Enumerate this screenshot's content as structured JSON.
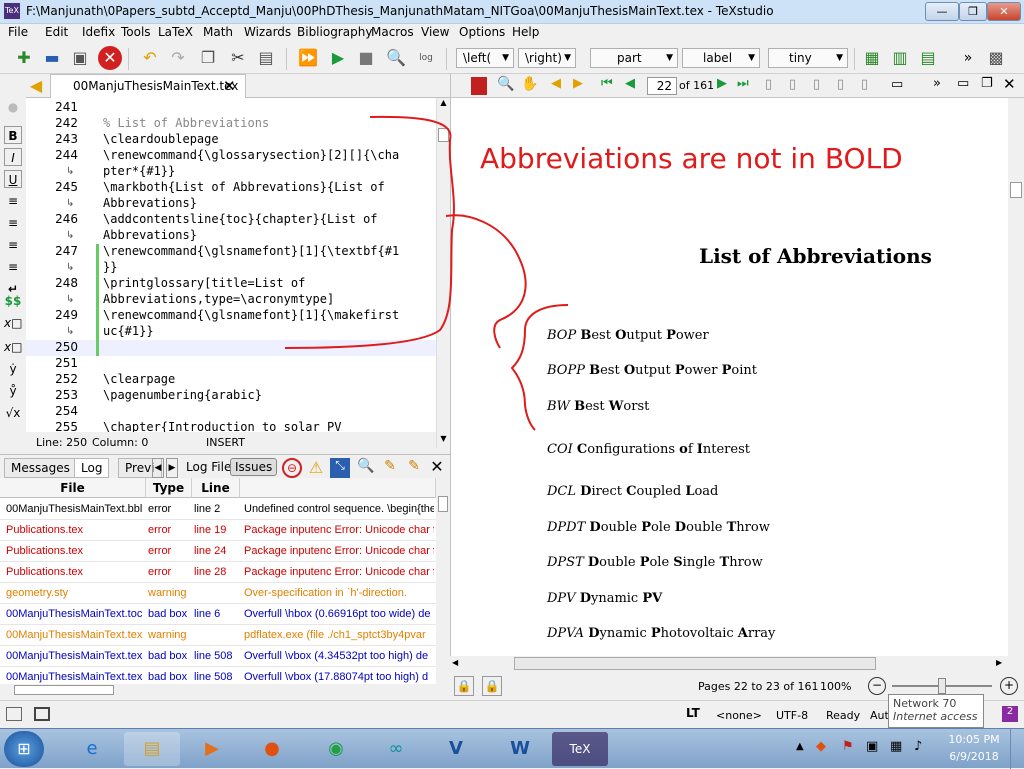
{
  "window": {
    "title": "F:\\Manjunath\\0Papers_subtd_Acceptd_Manju\\00PhDThesis_ManjunathMatam_NITGoa\\00ManjuThesisMainText.tex - TeXstudio",
    "min": "—",
    "max": "❐",
    "close": "✕"
  },
  "menu": [
    "File",
    "Edit",
    "Idefix",
    "Tools",
    "LaTeX",
    "Math",
    "Wizards",
    "Bibliography",
    "Macros",
    "View",
    "Options",
    "Help"
  ],
  "toolbar": {
    "left_combo": "\\left(",
    "right_combo": "\\right)",
    "part_combo": "part",
    "label_combo": "label",
    "size_combo": "tiny",
    "more": "»"
  },
  "left_strip": [
    "B",
    "I",
    "U",
    "≡",
    "≡",
    "≡",
    "≡",
    "↵",
    "$$",
    "x□",
    "x□",
    "ẏ",
    "ẙ",
    "√x"
  ],
  "editor": {
    "tab_label": "00ManjuThesisMainText.tex",
    "tab_close": "✕",
    "lines": [
      {
        "n": "241",
        "t": ""
      },
      {
        "n": "242",
        "t": "% List of Abbreviations"
      },
      {
        "n": "243",
        "t": "\\cleardoublepage"
      },
      {
        "n": "244",
        "t": "\\renewcommand{\\glossarysection}[2][]{\\cha"
      },
      {
        "n": "",
        "t": "pter*{#1}}"
      },
      {
        "n": "245",
        "t": "\\markboth{List of Abbrevations}{List of"
      },
      {
        "n": "",
        "t": "Abbrevations}"
      },
      {
        "n": "246",
        "t": "\\addcontentsline{toc}{chapter}{List of"
      },
      {
        "n": "",
        "t": "Abbrevations}"
      },
      {
        "n": "247",
        "t": "\\renewcommand{\\glsnamefont}[1]{\\textbf{#1"
      },
      {
        "n": "",
        "t": "}}"
      },
      {
        "n": "248",
        "t": "\\printglossary[title=List of"
      },
      {
        "n": "",
        "t": "Abbreviations,type=\\acronymtype]"
      },
      {
        "n": "249",
        "t": "\\renewcommand{\\glsnamefont}[1]{\\makefirst"
      },
      {
        "n": "",
        "t": "uc{#1}}"
      },
      {
        "n": "250",
        "t": ""
      },
      {
        "n": "251",
        "t": ""
      },
      {
        "n": "252",
        "t": "\\clearpage"
      },
      {
        "n": "253",
        "t": "\\pagenumbering{arabic}"
      },
      {
        "n": "254",
        "t": ""
      },
      {
        "n": "255",
        "t": "\\chapter{Introduction to solar PV"
      }
    ],
    "status": {
      "line": "Line: 250",
      "column": "Column: 0",
      "mode": "INSERT"
    }
  },
  "messages": {
    "tabs": [
      "Messages",
      "Log",
      "Previ"
    ],
    "log_file_label": "Log File",
    "issues_label": "Issues",
    "columns": [
      "File",
      "Type",
      "Line"
    ],
    "rows": [
      {
        "file": "00ManjuThesisMainText.bbl",
        "type": "error",
        "line": "line 2",
        "msg": "Undefined control sequence. \\begin{the",
        "color": "#000000"
      },
      {
        "file": "Publications.tex",
        "type": "error",
        "line": "line 19",
        "msg": "Package inputenc Error: Unicode char f",
        "color": "#d00000"
      },
      {
        "file": "Publications.tex",
        "type": "error",
        "line": "line 24",
        "msg": "Package inputenc Error: Unicode char f",
        "color": "#d00000"
      },
      {
        "file": "Publications.tex",
        "type": "error",
        "line": "line 28",
        "msg": "Package inputenc Error: Unicode char f",
        "color": "#d00000"
      },
      {
        "file": "geometry.sty",
        "type": "warning",
        "line": "",
        "msg": "Over-specification in `h'-direction.",
        "color": "#e08000"
      },
      {
        "file": "00ManjuThesisMainText.toc",
        "type": "bad box",
        "line": "line 6",
        "msg": "Overfull \\hbox (0.66916pt too wide) de",
        "color": "#0000c0"
      },
      {
        "file": "00ManjuThesisMainText.tex",
        "type": "warning",
        "line": "",
        "msg": "pdflatex.exe (file ./ch1_sptct3by4pvar",
        "color": "#e08000"
      },
      {
        "file": "00ManjuThesisMainText.tex",
        "type": "bad box",
        "line": "line 508",
        "msg": "Overfull \\vbox (4.34532pt too high) de",
        "color": "#0000c0"
      },
      {
        "file": "00ManjuThesisMainText.tex",
        "type": "bad box",
        "line": "line 508",
        "msg": "Overfull \\vbox (17.88074pt too high) d",
        "color": "#0000c0"
      }
    ]
  },
  "pdf": {
    "page_input": "22",
    "page_total": "of 161",
    "heading": "List of Abbreviations",
    "entries": [
      {
        "abbr": "BOP",
        "desc": [
          [
            "B",
            "est "
          ],
          [
            "O",
            "utput "
          ],
          [
            "P",
            "ower"
          ]
        ]
      },
      {
        "abbr": "BOPP",
        "desc": [
          [
            "B",
            "est "
          ],
          [
            "O",
            "utput "
          ],
          [
            "P",
            "ower "
          ],
          [
            "P",
            "oint"
          ]
        ]
      },
      {
        "abbr": "BW",
        "desc": [
          [
            "B",
            "est "
          ],
          [
            "W",
            "orst"
          ]
        ]
      },
      {
        "abbr": "COI",
        "desc": [
          [
            "C",
            "onfigurations "
          ],
          [
            "o",
            "f "
          ],
          [
            "I",
            "nterest"
          ]
        ]
      },
      {
        "abbr": "DCL",
        "desc": [
          [
            "D",
            "irect "
          ],
          [
            "C",
            "oupled "
          ],
          [
            "L",
            "oad"
          ]
        ]
      },
      {
        "abbr": "DPDT",
        "desc": [
          [
            "D",
            "ouble "
          ],
          [
            "P",
            "ole "
          ],
          [
            "D",
            "ouble "
          ],
          [
            "T",
            "hrow"
          ]
        ]
      },
      {
        "abbr": "DPST",
        "desc": [
          [
            "D",
            "ouble "
          ],
          [
            "P",
            "ole "
          ],
          [
            "S",
            "ingle "
          ],
          [
            "T",
            "hrow"
          ]
        ]
      },
      {
        "abbr": "DPV",
        "desc": [
          [
            "D",
            "ynamic "
          ],
          [
            "PV",
            ""
          ]
        ]
      },
      {
        "abbr": "DPVA",
        "desc": [
          [
            "D",
            "ynamic "
          ],
          [
            "P",
            "hotovoltaic "
          ],
          [
            "A",
            "rray"
          ]
        ]
      }
    ],
    "status_pages": "Pages 22 to 23 of 161",
    "zoom": "100%"
  },
  "annotation": "Abbreviations are not in BOLD",
  "statusbar": {
    "lt": "LT",
    "none": "<none>",
    "encoding": "UTF-8",
    "ready": "Ready",
    "auto": "Aut"
  },
  "tooltip": {
    "line1": "Network  70",
    "line2": "Internet access"
  },
  "taskbar": {
    "time": "10:05 PM",
    "date": "6/9/2018"
  }
}
